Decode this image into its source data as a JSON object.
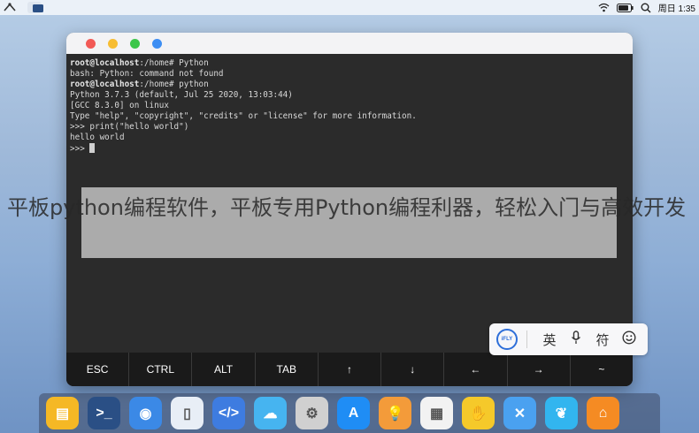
{
  "menubar": {
    "time": "周日 1:35"
  },
  "terminal": {
    "lines": [
      {
        "prompt": "root@localhost",
        "path": ":/home#",
        "cmd": " Python"
      },
      {
        "text": "bash: Python: command not found"
      },
      {
        "prompt": "root@localhost",
        "path": ":/home#",
        "cmd": " python"
      },
      {
        "text": "Python 3.7.3 (default, Jul 25 2020, 13:03:44)"
      },
      {
        "text": "[GCC 8.3.0] on linux"
      },
      {
        "text": "Type \"help\", \"copyright\", \"credits\" or \"license\" for more information."
      },
      {
        "text": ">>> print(\"hello world\")"
      },
      {
        "text": "hello world"
      },
      {
        "text": ">>> "
      }
    ]
  },
  "keybar": {
    "keys": [
      "ESC",
      "CTRL",
      "ALT",
      "TAB",
      "↑",
      "↓",
      "←",
      "→",
      "~"
    ]
  },
  "ime": {
    "logo": "iFLY",
    "lang": "英",
    "mic": "🎙",
    "symbol": "符",
    "emoji": "☺"
  },
  "caption": "平板python编程软件，平板专用Python编程利器，轻松入门与高效开发",
  "dock": {
    "icons": [
      {
        "name": "files-icon",
        "color": "#f5b825",
        "glyph": "▤"
      },
      {
        "name": "terminal-icon",
        "color": "#2a4f85",
        "glyph": ">_"
      },
      {
        "name": "planet-icon",
        "color": "#3b89e6",
        "glyph": "◉"
      },
      {
        "name": "notes-icon",
        "color": "#e8eef6",
        "glyph": "▯"
      },
      {
        "name": "code-icon",
        "color": "#3e7ce0",
        "glyph": "</>"
      },
      {
        "name": "cloud-icon",
        "color": "#46b4f0",
        "glyph": "☁"
      },
      {
        "name": "settings-icon",
        "color": "#d0d0d0",
        "glyph": "⚙"
      },
      {
        "name": "appstore-icon",
        "color": "#1f8df5",
        "glyph": "A"
      },
      {
        "name": "lightbulb-icon",
        "color": "#f39b3a",
        "glyph": "💡"
      },
      {
        "name": "calculator-icon",
        "color": "#f2f2f2",
        "glyph": "▦"
      },
      {
        "name": "touch-icon",
        "color": "#f5c92a",
        "glyph": "✋"
      },
      {
        "name": "tools-icon",
        "color": "#4aa1f0",
        "glyph": "✕"
      },
      {
        "name": "butterfly-icon",
        "color": "#32b5ef",
        "glyph": "❦"
      },
      {
        "name": "network-icon",
        "color": "#f58b23",
        "glyph": "⌂"
      }
    ]
  }
}
